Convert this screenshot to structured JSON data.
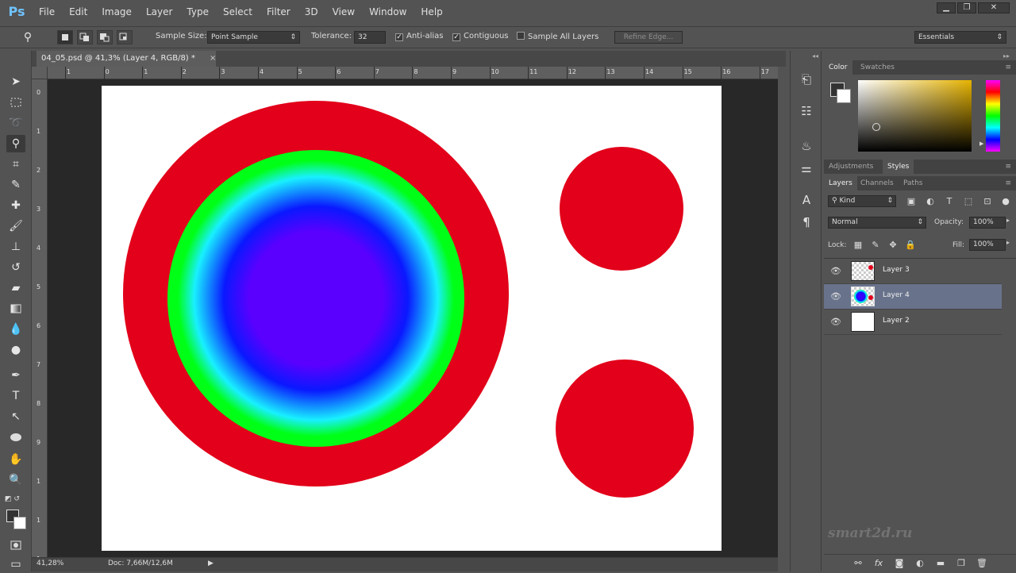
{
  "app": {
    "logo": "Ps",
    "menus": [
      "File",
      "Edit",
      "Image",
      "Layer",
      "Type",
      "Select",
      "Filter",
      "3D",
      "View",
      "Window",
      "Help"
    ],
    "window_controls": {
      "minimize": "▁",
      "restore": "❐",
      "close": "✕"
    }
  },
  "options": {
    "sample_size_label": "Sample Size:",
    "sample_size_value": "Point Sample",
    "tolerance_label": "Tolerance:",
    "tolerance_value": "32",
    "antialias_label": "Anti-alias",
    "contiguous_label": "Contiguous",
    "sample_all_layers_label": "Sample All Layers",
    "refine_edge_label": "Refine Edge...",
    "workspace": "Essentials",
    "antialias_checked": true,
    "contiguous_checked": true,
    "sample_all_layers_checked": false
  },
  "document": {
    "tab_title": "04_05.psd @ 41,3% (Layer 4, RGB/8) *",
    "tab_close": "×",
    "zoom": "41,28%",
    "doc_info": "Doc: 7,66M/12,6M"
  },
  "rulers": {
    "top": [
      "1",
      "0",
      "1",
      "2",
      "3",
      "4",
      "5",
      "6",
      "7",
      "8",
      "9",
      "10",
      "11",
      "12",
      "13",
      "14",
      "15",
      "16",
      "17"
    ],
    "left": [
      "0",
      "1",
      "2",
      "3",
      "4",
      "5",
      "6",
      "7",
      "8",
      "9",
      "1",
      "1",
      "1"
    ]
  },
  "panels": {
    "color_tabs": [
      "Color",
      "Swatches"
    ],
    "adjust_tabs": [
      "Adjustments",
      "Styles"
    ],
    "layer_tabs": [
      "Layers",
      "Channels",
      "Paths"
    ],
    "kind_label": "Kind",
    "blend_mode": "Normal",
    "opacity_label": "Opacity:",
    "opacity_value": "100%",
    "lock_label": "Lock:",
    "fill_label": "Fill:",
    "fill_value": "100%",
    "layers": [
      {
        "name": "Layer 3",
        "visible": true,
        "selected": false
      },
      {
        "name": "Layer 4",
        "visible": true,
        "selected": true
      },
      {
        "name": "Layer 2",
        "visible": true,
        "selected": false
      }
    ]
  },
  "watermark": "smart2d.ru",
  "colors": {
    "red": "#e2001a",
    "green": "#00ff17",
    "cyan": "#18f0ff",
    "blue": "#0a18ff",
    "violet": "#5a00ff",
    "selected_layer": "#68738b"
  }
}
